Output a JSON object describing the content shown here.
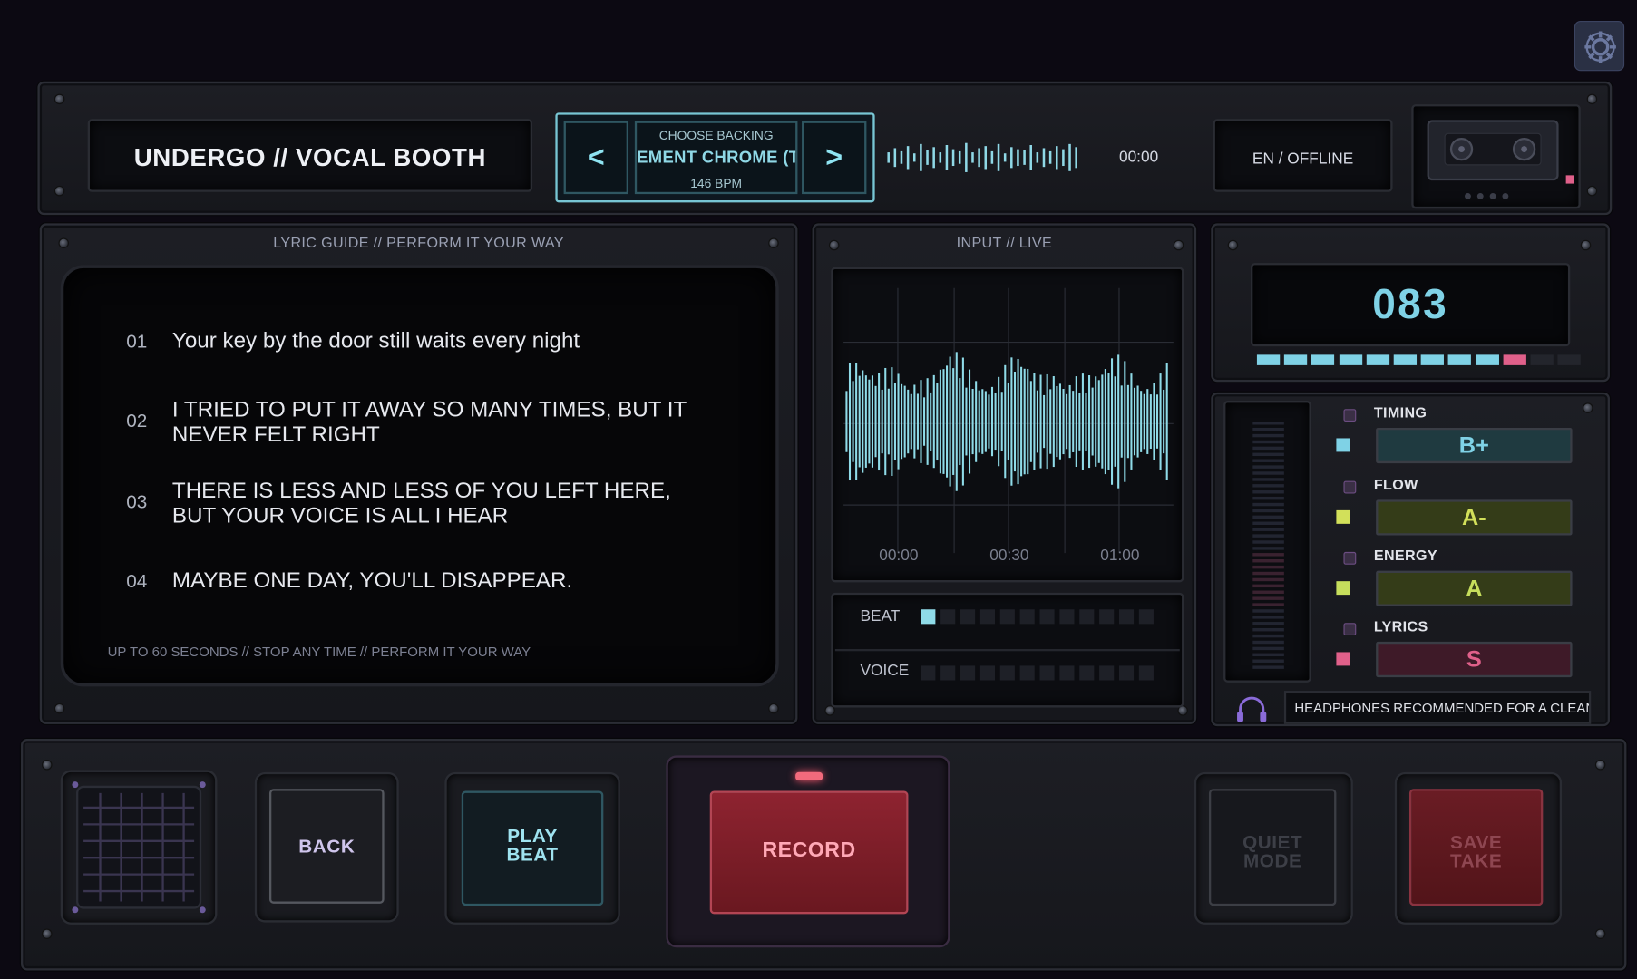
{
  "app": {
    "title": "UNDERGO // VOCAL BOOTH",
    "language_status": "EN / OFFLINE"
  },
  "backing": {
    "header": "CHOOSE BACKING",
    "track": "EMENT CHROME (T",
    "bpm": "146 BPM",
    "prev_label": "<",
    "next_label": ">"
  },
  "playback": {
    "time": "00:00"
  },
  "lyrics": {
    "header": "LYRIC GUIDE // PERFORM IT YOUR WAY",
    "lines": [
      {
        "num": "01",
        "text": "Your key by the door still waits every night"
      },
      {
        "num": "02",
        "text": "I TRIED TO PUT IT AWAY SO MANY TIMES, BUT IT NEVER FELT RIGHT"
      },
      {
        "num": "03",
        "text": "THERE IS LESS AND LESS OF YOU LEFT HERE, BUT YOUR VOICE IS ALL I HEAR"
      },
      {
        "num": "04",
        "text": "MAYBE ONE DAY, YOU'LL DISAPPEAR."
      }
    ],
    "footer": "UP TO 60 SECONDS // STOP ANY TIME // PERFORM IT YOUR WAY"
  },
  "input": {
    "header": "INPUT // LIVE",
    "time_ticks": [
      "00:00",
      "00:30",
      "01:00"
    ],
    "beat_label": "BEAT",
    "voice_label": "VOICE",
    "beat_level": 0.083,
    "voice_level": 0.0
  },
  "score": {
    "value": "083",
    "segments_on": 9,
    "segments_total": 10
  },
  "grades": [
    {
      "label": "TIMING",
      "grade": "B+",
      "color": "#7fd2e6"
    },
    {
      "label": "FLOW",
      "grade": "A-",
      "color": "#d2e05a"
    },
    {
      "label": "ENERGY",
      "grade": "A",
      "color": "#c6de5c"
    },
    {
      "label": "LYRICS",
      "grade": "S",
      "color": "#e0608a"
    }
  ],
  "headphones_note": "HEADPHONES RECOMMENDED FOR A CLEANE",
  "controls": {
    "back": "BACK",
    "play_beat_1": "PLAY",
    "play_beat_2": "BEAT",
    "record": "RECORD",
    "quiet_1": "QUIET",
    "quiet_2": "MODE",
    "save_1": "SAVE",
    "save_2": "TAKE"
  },
  "colors": {
    "accent_cyan": "#78c6d4",
    "record_red": "#8a1f28",
    "grade_pink": "#e0608a"
  }
}
